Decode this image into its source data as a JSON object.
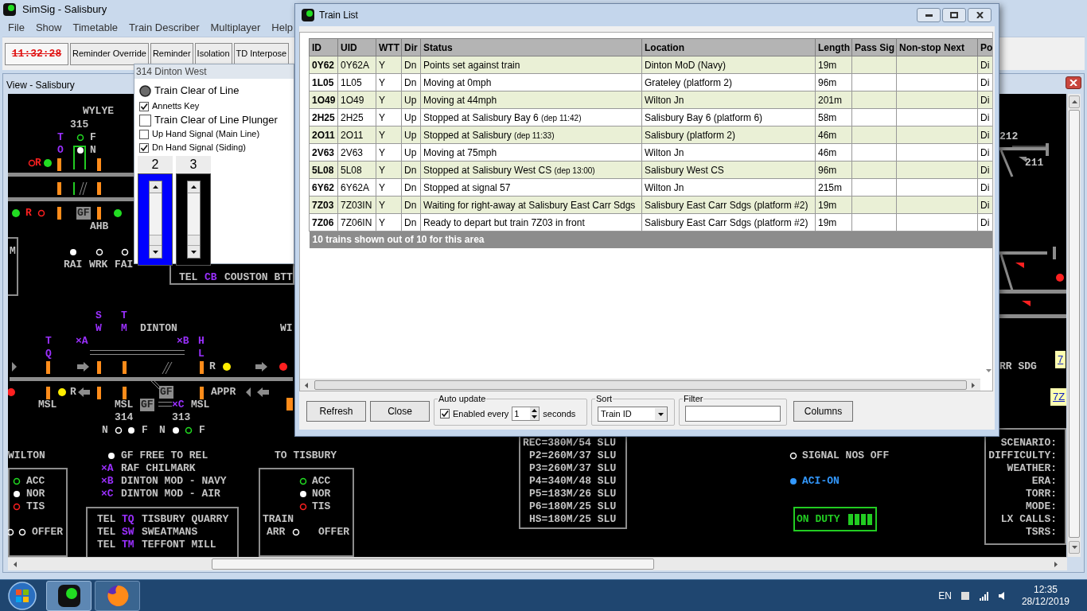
{
  "main_window": {
    "title": "SimSig - Salisbury"
  },
  "menu": [
    "File",
    "Show",
    "Timetable",
    "Train Describer",
    "Multiplayer",
    "Help"
  ],
  "toolbar": {
    "clock": "11:32:28",
    "buttons": [
      "Reminder Override",
      "Reminder",
      "Isolation",
      "TD Interpose"
    ]
  },
  "view": {
    "title": "View - Salisbury",
    "labels": [
      {
        "text": "WYLYE",
        "kind": "plain"
      },
      {
        "text": "315",
        "kind": "plain"
      },
      {
        "text": "T",
        "kind": "code"
      },
      {
        "text": "O",
        "kind": "code"
      },
      {
        "text": "F",
        "kind": "plain"
      },
      {
        "text": "N",
        "kind": "plain"
      },
      {
        "text": "R",
        "kind": "alarm"
      },
      {
        "text": "R",
        "kind": "alarm"
      },
      {
        "text": "GF",
        "kind": "boxed"
      },
      {
        "text": "AHB",
        "kind": "plain"
      },
      {
        "text": "M",
        "kind": "plain"
      },
      {
        "text": "RAI",
        "kind": "plain"
      },
      {
        "text": "WRK",
        "kind": "plain"
      },
      {
        "text": "FAI",
        "kind": "plain"
      },
      {
        "text": "TEL",
        "kind": "plain"
      },
      {
        "text": "CB",
        "kind": "code"
      },
      {
        "text": "COUSTON BTT",
        "kind": "plain"
      },
      {
        "text": "S",
        "kind": "code"
      },
      {
        "text": "W",
        "kind": "code"
      },
      {
        "text": "T",
        "kind": "code"
      },
      {
        "text": "M",
        "kind": "code"
      },
      {
        "text": "DINTON",
        "kind": "plain"
      },
      {
        "text": "WI",
        "kind": "plain"
      },
      {
        "text": "T",
        "kind": "code"
      },
      {
        "text": "Q",
        "kind": "code"
      },
      {
        "text": "×A",
        "kind": "code"
      },
      {
        "text": "×B",
        "kind": "code"
      },
      {
        "text": "H",
        "kind": "code"
      },
      {
        "text": "L",
        "kind": "code"
      },
      {
        "text": "R",
        "kind": "plain"
      },
      {
        "text": "R",
        "kind": "plain"
      },
      {
        "text": "APPR",
        "kind": "plain"
      },
      {
        "text": "MSL",
        "kind": "plain"
      },
      {
        "text": "MSL",
        "kind": "plain"
      },
      {
        "text": "GF",
        "kind": "boxed"
      },
      {
        "text": "GF",
        "kind": "boxed"
      },
      {
        "text": "×C",
        "kind": "code"
      },
      {
        "text": "MSL",
        "kind": "plain"
      },
      {
        "text": "314",
        "kind": "plain"
      },
      {
        "text": "313",
        "kind": "plain"
      },
      {
        "text": "N",
        "kind": "plain"
      },
      {
        "text": "F",
        "kind": "plain"
      },
      {
        "text": "N",
        "kind": "plain"
      },
      {
        "text": "F",
        "kind": "plain"
      },
      {
        "text": "WILTON",
        "kind": "plain"
      },
      {
        "text": "GF FREE TO REL",
        "kind": "plain"
      },
      {
        "text": "TO TISBURY",
        "kind": "plain"
      },
      {
        "text": "×A",
        "kind": "code"
      },
      {
        "text": "RAF CHILMARK",
        "kind": "plain"
      },
      {
        "text": "×B",
        "kind": "code"
      },
      {
        "text": "DINTON MOD - NAVY",
        "kind": "plain"
      },
      {
        "text": "×C",
        "kind": "code"
      },
      {
        "text": "DINTON MOD - AIR",
        "kind": "plain"
      },
      {
        "text": "ACC",
        "kind": "plain"
      },
      {
        "text": "NOR",
        "kind": "plain"
      },
      {
        "text": "TIS",
        "kind": "plain"
      },
      {
        "text": "OFFER",
        "kind": "plain"
      },
      {
        "text": "TEL",
        "kind": "plain"
      },
      {
        "text": "TQ",
        "kind": "code"
      },
      {
        "text": "TISBURY QUARRY",
        "kind": "plain"
      },
      {
        "text": "TEL",
        "kind": "plain"
      },
      {
        "text": "SW",
        "kind": "code"
      },
      {
        "text": "SWEATMANS",
        "kind": "plain"
      },
      {
        "text": "TEL",
        "kind": "plain"
      },
      {
        "text": "TM",
        "kind": "code"
      },
      {
        "text": "TEFFONT MILL",
        "kind": "plain"
      },
      {
        "text": "ACC",
        "kind": "plain"
      },
      {
        "text": "NOR",
        "kind": "plain"
      },
      {
        "text": "TIS",
        "kind": "plain"
      },
      {
        "text": "TRAIN",
        "kind": "plain"
      },
      {
        "text": "ARR",
        "kind": "plain"
      },
      {
        "text": "OFFER",
        "kind": "plain"
      },
      {
        "text": "REC=380M/54 SLU",
        "kind": "plain"
      },
      {
        "text": "P2=260M/37 SLU",
        "kind": "plain"
      },
      {
        "text": "P3=260M/37 SLU",
        "kind": "plain"
      },
      {
        "text": "P4=340M/48 SLU",
        "kind": "plain"
      },
      {
        "text": "P5=183M/26 SLU",
        "kind": "plain"
      },
      {
        "text": "P6=180M/25 SLU",
        "kind": "plain"
      },
      {
        "text": "HS=180M/25 SLU",
        "kind": "plain"
      },
      {
        "text": "SIGNAL NOS OFF",
        "kind": "plain"
      },
      {
        "text": "ACI-ON",
        "kind": "accent"
      },
      {
        "text": "ON DUTY",
        "kind": "duty"
      },
      {
        "text": "SCENARIO:",
        "kind": "info"
      },
      {
        "text": "DIFFICULTY:",
        "kind": "info"
      },
      {
        "text": "WEATHER:",
        "kind": "info"
      },
      {
        "text": "ERA:",
        "kind": "info"
      },
      {
        "text": "TORR:",
        "kind": "info"
      },
      {
        "text": "MODE:",
        "kind": "info"
      },
      {
        "text": "LX CALLS:",
        "kind": "info"
      },
      {
        "text": "TSRS:",
        "kind": "info"
      },
      {
        "text": "212",
        "kind": "plain"
      },
      {
        "text": "211",
        "kind": "plain"
      },
      {
        "text": "RR SDG",
        "kind": "plain"
      },
      {
        "text": "7",
        "kind": "tag"
      },
      {
        "text": "7Z",
        "kind": "tag"
      }
    ],
    "indicators": [
      {
        "color": "#ff2020",
        "on": false
      },
      {
        "color": "#22dd22",
        "on": true
      },
      {
        "color": "#22dd22",
        "on": false
      },
      {
        "color": "#ffffff",
        "on": true
      },
      {
        "color": "#22dd22",
        "on": true
      },
      {
        "color": "#ff2020",
        "on": false
      },
      {
        "color": "#22dd22",
        "on": true
      },
      {
        "color": "#ffffff",
        "on": true
      },
      {
        "color": "#ffffff",
        "on": false
      },
      {
        "color": "#ffffff",
        "on": false
      },
      {
        "color": "#ffee00",
        "on": true
      },
      {
        "color": "#ff2020",
        "on": true
      },
      {
        "color": "#ff2020",
        "on": true
      },
      {
        "color": "#ffee00",
        "on": true
      },
      {
        "color": "#ffffff",
        "on": false
      },
      {
        "color": "#ffffff",
        "on": true
      },
      {
        "color": "#ffffff",
        "on": true
      },
      {
        "color": "#22dd22",
        "on": false
      },
      {
        "color": "#ffffff",
        "on": true
      },
      {
        "color": "#22dd22",
        "on": false
      },
      {
        "color": "#ffffff",
        "on": true
      },
      {
        "color": "#ff2020",
        "on": false
      },
      {
        "color": "#ffffff",
        "on": false
      },
      {
        "color": "#ffffff",
        "on": false
      },
      {
        "color": "#22dd22",
        "on": false
      },
      {
        "color": "#ffffff",
        "on": true
      },
      {
        "color": "#ff2020",
        "on": false
      },
      {
        "color": "#ffffff",
        "on": false
      },
      {
        "color": "#ffffff",
        "on": false
      },
      {
        "color": "#3399ff",
        "on": true
      },
      {
        "color": "#ff2020",
        "on": true
      }
    ]
  },
  "popup": {
    "title": "314 Dinton West",
    "items": [
      {
        "label": "Train Clear of Line",
        "kind": "button"
      },
      {
        "label": "Annetts Key",
        "kind": "checkbox",
        "checked": true
      },
      {
        "label": "Train Clear of Line Plunger",
        "kind": "large_checkbox",
        "checked": false
      },
      {
        "label": "Up Hand Signal (Main Line)",
        "kind": "checkbox",
        "checked": false
      },
      {
        "label": "Dn Hand Signal (Siding)",
        "kind": "checkbox",
        "checked": true
      }
    ],
    "levers": [
      {
        "label": "2",
        "selected": true
      },
      {
        "label": "3",
        "selected": false
      }
    ]
  },
  "train_list": {
    "title": "Train List",
    "columns": [
      "ID",
      "UID",
      "WTT",
      "Dir",
      "Status",
      "Location",
      "Length",
      "Pass Sig",
      "Non-stop Next",
      "Po"
    ],
    "rows": [
      {
        "id": "0Y62",
        "uid": "0Y62A",
        "wtt": "Y",
        "dir": "Dn",
        "status": "Points set against train",
        "location": "Dinton MoD (Navy)",
        "length": "19m",
        "column_10": "Di"
      },
      {
        "id": "1L05",
        "uid": "1L05",
        "wtt": "Y",
        "dir": "Dn",
        "status": "Moving at 0mph",
        "location": "Grateley (platform 2)",
        "length": "96m",
        "column_10": "Di"
      },
      {
        "id": "1O49",
        "uid": "1O49",
        "wtt": "Y",
        "dir": "Up",
        "status": "Moving at 44mph",
        "location": "Wilton Jn",
        "length": "201m",
        "column_10": "Di"
      },
      {
        "id": "2H25",
        "uid": "2H25",
        "wtt": "Y",
        "dir": "Up",
        "status": "Stopped at Salisbury Bay 6",
        "dep": "(dep 11:42)",
        "location": "Salisbury Bay 6 (platform 6)",
        "length": "58m",
        "column_10": "Di"
      },
      {
        "id": "2O11",
        "uid": "2O11",
        "wtt": "Y",
        "dir": "Up",
        "status": "Stopped at Salisbury",
        "dep": "(dep 11:33)",
        "location": "Salisbury (platform 2)",
        "length": "46m",
        "column_10": "Di"
      },
      {
        "id": "2V63",
        "uid": "2V63",
        "wtt": "Y",
        "dir": "Up",
        "status": "Moving at 75mph",
        "location": "Wilton Jn",
        "length": "46m",
        "column_10": "Di"
      },
      {
        "id": "5L08",
        "uid": "5L08",
        "wtt": "Y",
        "dir": "Dn",
        "status": "Stopped at Salisbury West CS",
        "dep": "(dep 13:00)",
        "location": "Salisbury West CS",
        "length": "96m",
        "column_10": "Di"
      },
      {
        "id": "6Y62",
        "uid": "6Y62A",
        "wtt": "Y",
        "dir": "Dn",
        "status": "Stopped at signal 57",
        "location": "Wilton Jn",
        "length": "215m",
        "column_10": "Di"
      },
      {
        "id": "7Z03",
        "uid": "7Z03IN",
        "wtt": "Y",
        "dir": "Dn",
        "status": "Waiting for right-away at Salisbury East Carr Sdgs",
        "location": "Salisbury East Carr Sdgs (platform #2)",
        "length": "19m",
        "column_10": "Di"
      },
      {
        "id": "7Z06",
        "uid": "7Z06IN",
        "wtt": "Y",
        "dir": "Dn",
        "status": "Ready to depart but train 7Z03 in front",
        "location": "Salisbury East Carr Sdgs (platform #2)",
        "length": "19m",
        "column_10": "Di"
      }
    ],
    "summary": "10 trains shown out of 10 for this area",
    "buttons": [
      "Refresh",
      "Close"
    ],
    "auto_update": {
      "label": "Auto update",
      "checkbox": "Enabled every",
      "checked": true,
      "interval": "1",
      "unit": "seconds"
    },
    "sort": {
      "label": "Sort",
      "value": "Train ID"
    },
    "filter": {
      "label": "Filter"
    },
    "columns_button": "Columns"
  },
  "taskbar": {
    "language": "EN",
    "time": "12:35",
    "date": "28/12/2019"
  }
}
